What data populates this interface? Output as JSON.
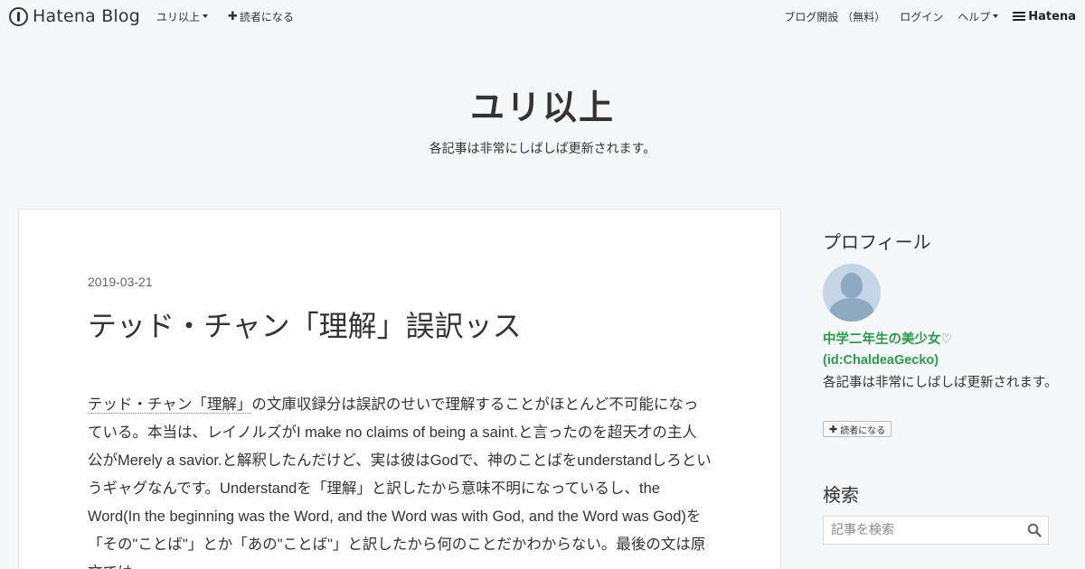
{
  "topbar": {
    "logo": "Hatena Blog",
    "blog_menu": "ユリ以上",
    "subscribe": "読者になる",
    "open_blog": "ブログ開設 （無料）",
    "login": "ログイン",
    "help": "ヘルプ",
    "hatena": "Hatena"
  },
  "blog": {
    "title": "ユリ以上",
    "description": "各記事は非常にしばしば更新されます。"
  },
  "entry": {
    "date": "2019-03-21",
    "title": "テッド・チャン「理解」誤訳ッス",
    "body_link": "テッド・チャン「理解」",
    "body_rest": "の文庫収録分は誤訳のせいで理解することがほとんど不可能になっている。本当は、レイノルズがI make no claims of being a saint.と言ったのを超天才の主人公がMerely a savior.と解釈したんだけど、実は彼はGodで、神のことばをunderstandしろというギャグなんです。Understandを「理解」と訳したから意味不明になっているし、the Word(In the beginning was the Word, and the Word was with God, and the Word was God)を「その\"ことば\"」とか「あの\"ことば\"」と訳したから何のことだかわからない。最後の文は原文では"
  },
  "sidebar": {
    "profile_title": "プロフィール",
    "profile_name": "中学二年生の美少女♡",
    "profile_id": "(id:ChaldeaGecko)",
    "profile_desc": "各記事は非常にしばしば更新されます。",
    "subscribe_button": "読者になる",
    "search_title": "検索",
    "search_placeholder": "記事を検索"
  }
}
